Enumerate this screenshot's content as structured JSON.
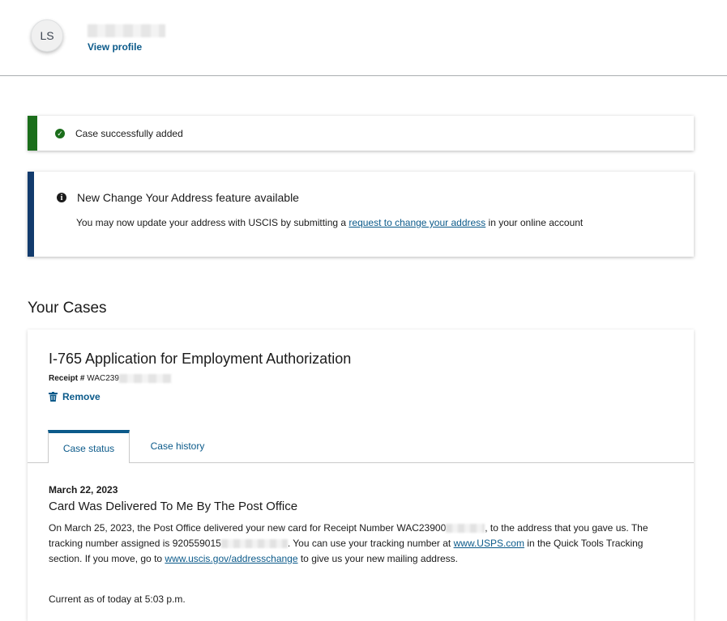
{
  "profile": {
    "initials": "LS",
    "view_profile_label": "View profile"
  },
  "alerts": {
    "success": {
      "text": "Case successfully added",
      "icon": "check-circle-icon",
      "color": "#1b6e1b"
    },
    "info": {
      "heading": "New Change Your Address feature available",
      "body_prefix": "You may now update your address with USCIS by submitting a ",
      "link_text": "request to change your address",
      "body_suffix": " in your online account",
      "icon": "info-circle-icon",
      "color": "#123b6d"
    }
  },
  "cases": {
    "section_title": "Your Cases",
    "card": {
      "title": "I-765 Application for Employment Authorization",
      "receipt_label": "Receipt #",
      "receipt_value": "WAC239",
      "remove_label": "Remove",
      "tabs": [
        {
          "label": "Case status",
          "active": true
        },
        {
          "label": "Case history",
          "active": false
        }
      ],
      "status": {
        "date": "March 22, 2023",
        "title": "Card Was Delivered To Me By The Post Office",
        "body_part1": "On March 25, 2023, the Post Office delivered your new card for Receipt Number WAC23900",
        "body_part2": ", to the address that you gave us. The tracking number assigned is 920559015",
        "body_part3": ". You can use your tracking number at ",
        "usps_link": "www.USPS.com",
        "body_part4": " in the Quick Tools Tracking section. If you move, go to ",
        "address_link": "www.uscis.gov/addresschange",
        "body_part5": " to give us your new mailing address.",
        "current_as_of": "Current as of today at 5:03 p.m."
      }
    }
  },
  "colors": {
    "link": "#0b5a8a",
    "success_border": "#1b6e1b",
    "info_border": "#123b6d"
  }
}
